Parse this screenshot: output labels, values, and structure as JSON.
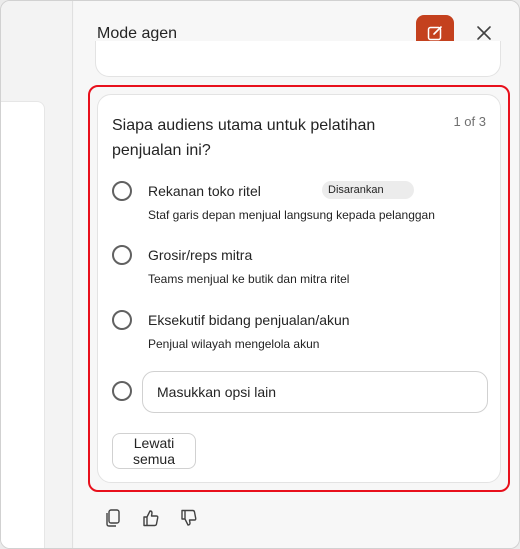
{
  "header": {
    "title": "Mode agen"
  },
  "question": {
    "text": "Siapa audiens utama untuk pelatihan penjualan ini?",
    "counter": "1 of 3",
    "options": [
      {
        "title": "Rekanan toko ritel",
        "description": "Staf garis depan menjual langsung kepada pelanggan",
        "badge": "Disarankan"
      },
      {
        "title": "Grosir/reps mitra",
        "description": "Teams menjual ke butik dan mitra ritel"
      },
      {
        "title": "Eksekutif bidang penjualan/akun",
        "description": "Penjual wilayah mengelola akun"
      }
    ],
    "other_placeholder": "Masukkan opsi lain",
    "skip_label": "Lewati semua"
  },
  "colors": {
    "accent": "#c4411e",
    "highlight": "#e8101c"
  },
  "icons": {
    "new": "edit-square-icon",
    "close": "close-icon",
    "copy": "copy-icon",
    "like": "thumbs-up-icon",
    "dislike": "thumbs-down-icon"
  }
}
